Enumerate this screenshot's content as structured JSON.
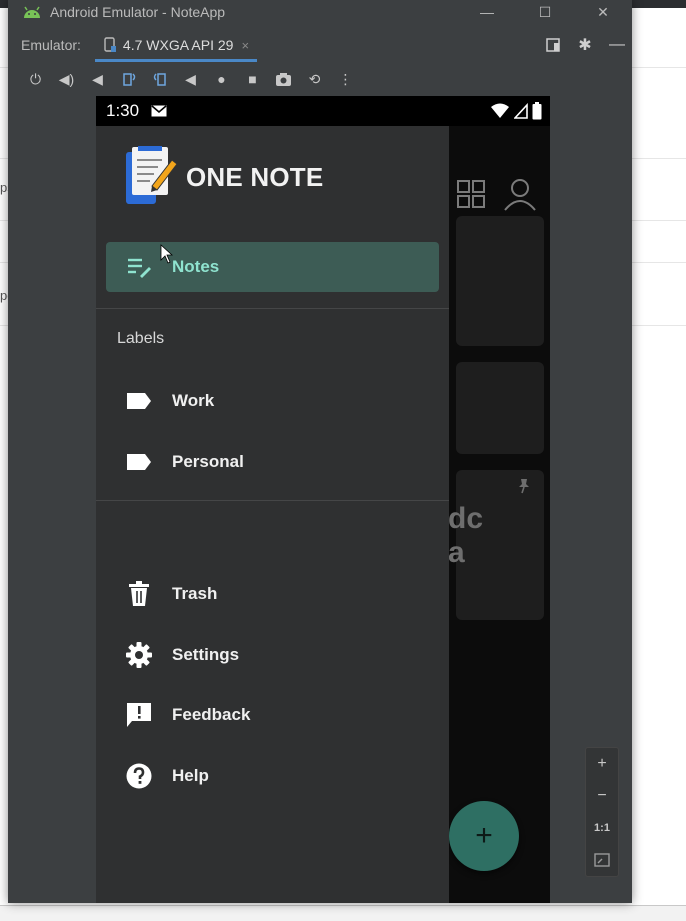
{
  "window": {
    "title": "Android Emulator - NoteApp",
    "minimize": "—",
    "maximize": "☐",
    "close": "✕"
  },
  "tabs": {
    "emulator_label": "Emulator:",
    "device_tab": "4.7 WXGA API 29",
    "close": "×"
  },
  "device": {
    "time": "1:30"
  },
  "drawer": {
    "brand": "ONE NOTE",
    "notes_label": "Notes",
    "labels_title": "Labels",
    "labels": [
      "Work",
      "Personal"
    ],
    "trash": "Trash",
    "settings": "Settings",
    "feedback": "Feedback",
    "help": "Help"
  },
  "app_behind": {
    "card_text_line1": "dc",
    "card_text_line2": "a"
  },
  "fab": {
    "label": "+"
  },
  "zoom": {
    "in": "+",
    "out": "−",
    "one_to_one": "1:1"
  },
  "background_ide": {
    "frag1": "ps",
    "frag2": "po"
  },
  "colors": {
    "accent": "#3d5c55",
    "accent_text": "#8fe3cf",
    "drawer_bg": "#2f3031",
    "window_bg": "#3c3f41",
    "fab": "#2e6f63"
  }
}
